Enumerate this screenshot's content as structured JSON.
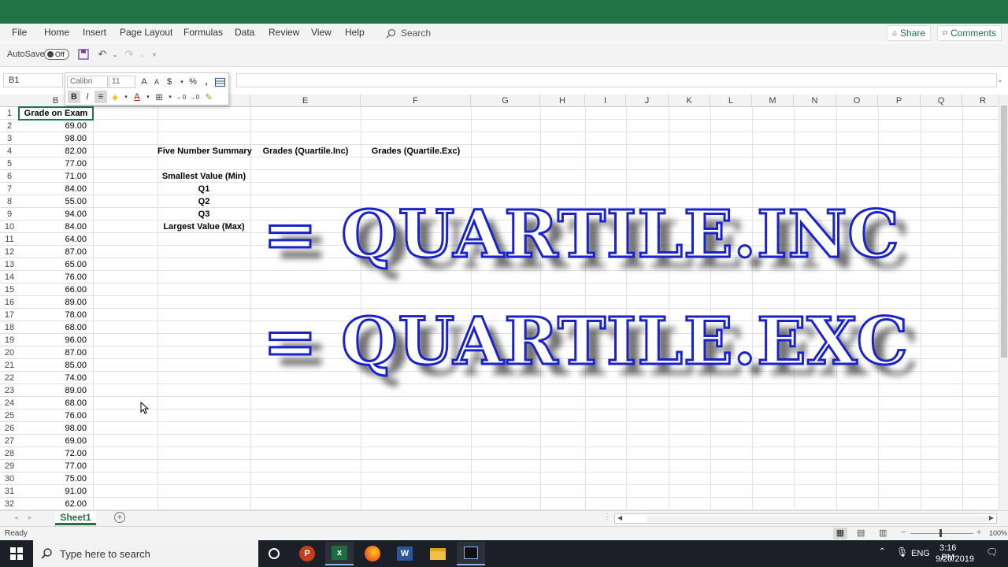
{
  "ribbon": {
    "tabs": [
      "File",
      "Home",
      "Insert",
      "Page Layout",
      "Formulas",
      "Data",
      "Review",
      "View",
      "Help"
    ],
    "search": "Search",
    "share": "Share",
    "comments": "Comments"
  },
  "qat": {
    "autosave_label": "AutoSave",
    "autosave_state": "Off"
  },
  "formula_bar": {
    "name_box": "B1",
    "formula": ""
  },
  "mini_toolbar": {
    "font": "Calibri",
    "size": "11",
    "bold": "B",
    "italic": "I"
  },
  "grid": {
    "columns": [
      "B",
      "C",
      "D",
      "E",
      "F",
      "G",
      "H",
      "I",
      "J",
      "K",
      "L",
      "M",
      "N",
      "O",
      "P",
      "Q",
      "R"
    ],
    "rows": [
      "1",
      "2",
      "3",
      "4",
      "5",
      "6",
      "7",
      "8",
      "9",
      "10",
      "11",
      "12",
      "13",
      "14",
      "15",
      "16",
      "17",
      "18",
      "19",
      "20",
      "21",
      "22",
      "23",
      "24",
      "25",
      "26",
      "27",
      "28",
      "29",
      "30",
      "31",
      "32"
    ],
    "b_header": "Grade on Exam",
    "b_values": [
      "69.00",
      "98.00",
      "82.00",
      "77.00",
      "71.00",
      "84.00",
      "55.00",
      "94.00",
      "84.00",
      "64.00",
      "87.00",
      "65.00",
      "76.00",
      "66.00",
      "89.00",
      "78.00",
      "68.00",
      "96.00",
      "87.00",
      "85.00",
      "74.00",
      "89.00",
      "68.00",
      "76.00",
      "98.00",
      "69.00",
      "72.00",
      "77.00",
      "75.00",
      "91.00",
      "62.00"
    ],
    "summary_title": "Five Number Summary",
    "e_header": "Grades (Quartile.Inc)",
    "f_header": "Grades (Quartile.Exc)",
    "summary_labels": [
      "Smallest Value (Min)",
      "Q1",
      "Q2",
      "Q3",
      "Largest Value (Max)"
    ]
  },
  "overlay": {
    "line1": "= QUARTILE.INC",
    "line2": "= QUARTILE.EXC"
  },
  "sheet": {
    "tab": "Sheet1"
  },
  "status": {
    "text": "Ready",
    "zoom": "100%"
  },
  "taskbar": {
    "search_placeholder": "Type here to search",
    "lang": "ENG",
    "time": "3:16 PM",
    "date": "9/20/2019",
    "apps": [
      "cortana-icon",
      "powerpoint-icon",
      "excel-icon",
      "firefox-icon",
      "word-icon",
      "file-explorer-icon",
      "terminal-icon"
    ]
  },
  "colors": {
    "excel_green": "#217346",
    "overlay_stroke": "#1a22c9"
  }
}
